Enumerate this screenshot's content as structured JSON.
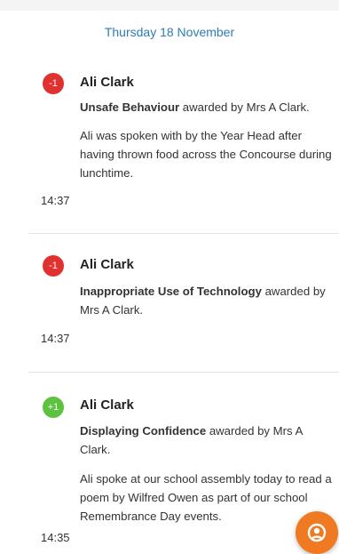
{
  "date_header": "Thursday 18 November",
  "entries": [
    {
      "badge": "-1",
      "badge_color": "#e0312f",
      "name": "Ali Clark",
      "behaviour": "Unsafe Behaviour",
      "award_text": " awarded by Mrs A Clark.",
      "note_lines": [
        "Ali was spoken with by the Year Head after",
        "having thrown food across the Concourse during",
        "lunchtime."
      ],
      "time": "14:37"
    },
    {
      "badge": "-1",
      "badge_color": "#e0312f",
      "name": "Ali Clark",
      "behaviour": "Inappropriate Use of Technology",
      "award_text_1": " awarded by",
      "award_text_2": "Mrs A Clark.",
      "time": "14:37"
    },
    {
      "badge": "+1",
      "badge_color": "#5cc23f",
      "name": "Ali Clark",
      "behaviour": "Displaying Confidence",
      "award_text_1": " awarded by Mrs A",
      "award_text_2": "Clark.",
      "note_lines": [
        "Ali spoke at our school assembly today to read a",
        "poem by Wilfred Owen as part of our school",
        "Remembrance Day events."
      ],
      "time": "14:35"
    }
  ],
  "fab": {
    "icon": "user-icon",
    "color": "#ef7a22"
  }
}
